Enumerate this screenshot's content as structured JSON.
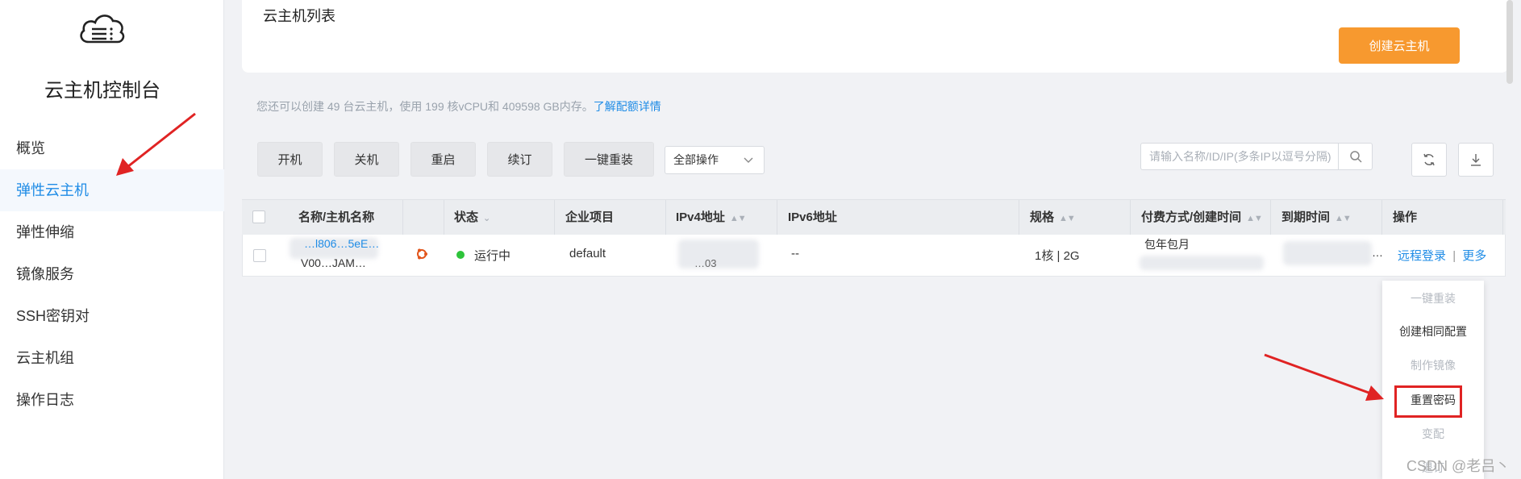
{
  "sidebar": {
    "title": "云主机控制台",
    "items": [
      {
        "label": "概览"
      },
      {
        "label": "弹性云主机"
      },
      {
        "label": "弹性伸缩"
      },
      {
        "label": "镜像服务"
      },
      {
        "label": "SSH密钥对"
      },
      {
        "label": "云主机组"
      },
      {
        "label": "操作日志"
      }
    ]
  },
  "header": {
    "title": "云主机列表",
    "create_button": "创建云主机"
  },
  "quota": {
    "text": "您还可以创建 49 台云主机，使用 199 核vCPU和 409598 GB内存。",
    "link": "了解配额详情"
  },
  "toolbar": {
    "buttons": [
      "开机",
      "关机",
      "重启",
      "续订",
      "一键重装"
    ],
    "select_label": "全部操作",
    "search_placeholder": "请输入名称/ID/IP(多条IP以逗号分隔)"
  },
  "table": {
    "headers": [
      "名称/主机名称",
      "状态",
      "企业项目",
      "IPv4地址",
      "IPv6地址",
      "规格",
      "付费方式/创建时间",
      "到期时间",
      "操作"
    ],
    "row": {
      "name": "…l806…5eE…",
      "hostname": "V00…JAM…",
      "status": "运行中",
      "project": "default",
      "ipv4_suffix": "…03",
      "ipv6": "--",
      "spec": "1核 | 2G",
      "billing": "包年包月",
      "expire_suffix": "…",
      "action_login": "远程登录",
      "action_sep": "|",
      "action_more": "更多"
    }
  },
  "more_menu": {
    "items": [
      {
        "label": "一键重装",
        "disabled": true
      },
      {
        "label": "创建相同配置",
        "disabled": false
      },
      {
        "label": "制作镜像",
        "disabled": true
      },
      {
        "label": "重置密码",
        "disabled": false
      },
      {
        "label": "变配",
        "disabled": true
      },
      {
        "label": "退订",
        "disabled": true
      }
    ]
  },
  "watermark": "CSDN @老吕丶",
  "colors": {
    "accent": "#1f8ce6",
    "create_button": "#f7992f",
    "status_running": "#2ec43b",
    "annotation": "#e02323"
  }
}
